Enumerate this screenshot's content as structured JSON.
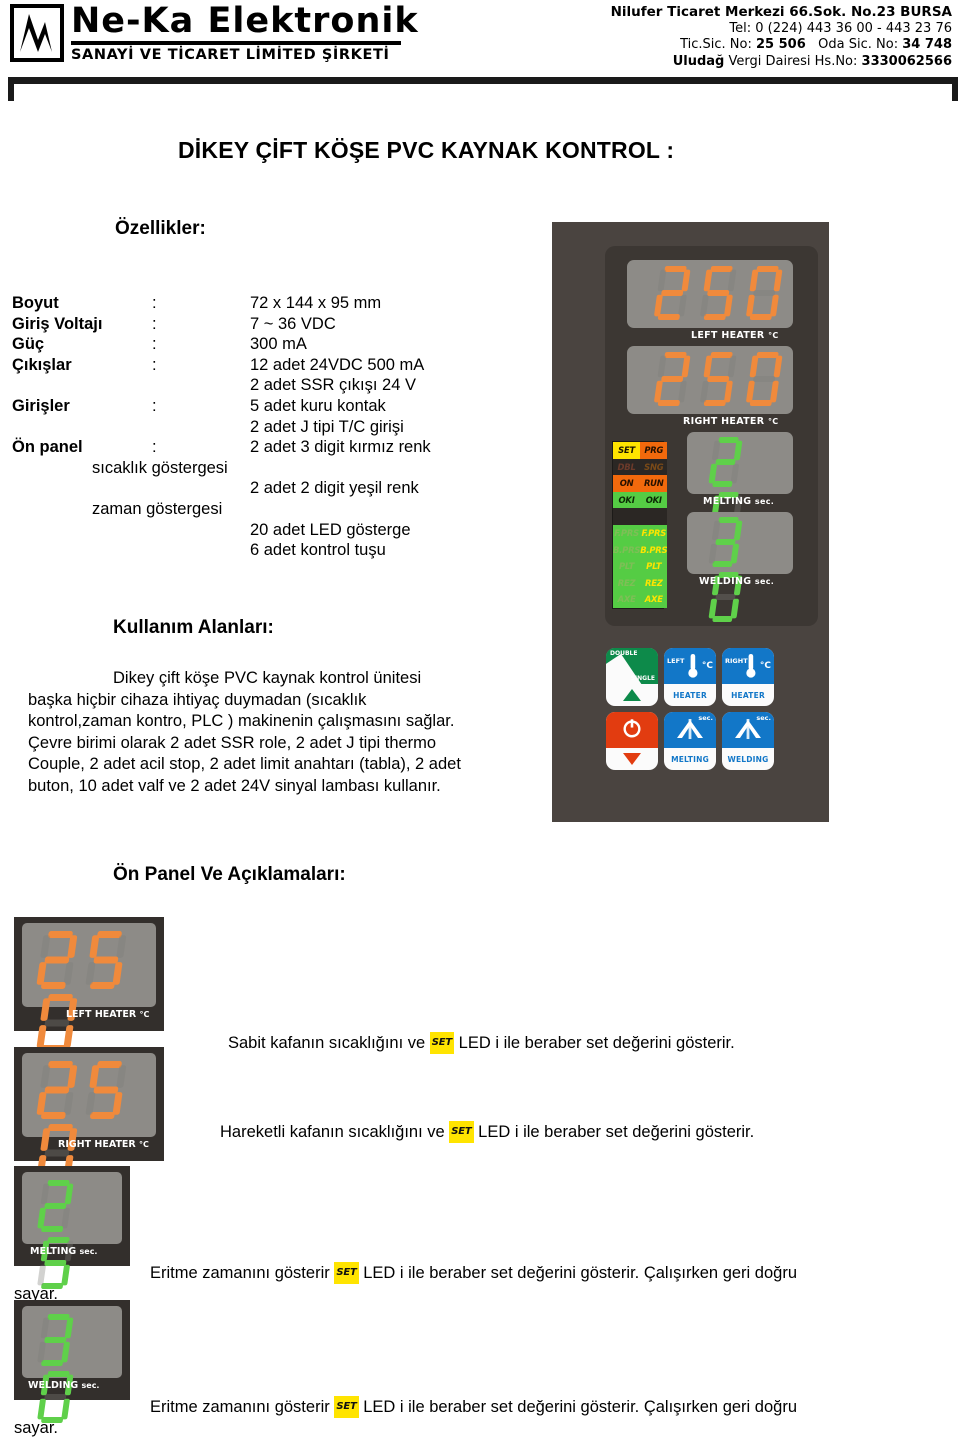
{
  "letterhead": {
    "logo": {
      "brand_main": "Ne-Ka Elektronik",
      "brand_sub": "SANAYİ VE TİCARET LİMİTED ŞİRKETİ",
      "mark_icon": "zigzag-waveform-logo-icon"
    },
    "company": {
      "address": "Nilufer Ticaret Merkezi 66.Sok. No.23 BURSA",
      "phone": "Tel: 0 (224) 443 36 00 - 443 23 76",
      "registry_label_1": "Tic.Sic. No:",
      "registry_value_1": "25 506",
      "registry_label_2": "Oda Sic. No:",
      "registry_value_2": "34 748",
      "tax_office_bold": "Uludağ",
      "tax_office_rest": "Vergi Dairesi  Hs.No:",
      "tax_no": "3330062566"
    }
  },
  "document": {
    "title": "DİKEY ÇİFT KÖŞE PVC KAYNAK KONTROL :",
    "features_heading": "Özellikler:",
    "usage_heading": "Kullanım Alanları:",
    "usage_text": "Dikey çift köşe PVC kaynak kontrol ünitesi başka hiçbir cihaza ihtiyaç duymadan (sıcaklık kontrol,zaman kontro, PLC ) makinenin çalışmasını sağlar. Çevre birimi olarak 2 adet SSR role, 2 adet J tipi thermo Couple, 2 adet acil stop, 2 adet limit anahtarı (tabla), 2 adet buton, 10 adet valf ve 2 adet 24V sinyal lambası kullanır.",
    "panel_heading": "Ön Panel Ve Açıklamaları:"
  },
  "specs": {
    "colon": ":",
    "rows": [
      {
        "label": "Boyut",
        "colon": ":",
        "value": "72 x 144 x 95 mm",
        "extra": []
      },
      {
        "label": "Giriş Voltajı",
        "colon": ":",
        "value": "7 ~ 36 VDC",
        "extra": []
      },
      {
        "label": "Güç",
        "colon": ":",
        "value": "300 mA",
        "extra": []
      },
      {
        "label": "Çıkışlar",
        "colon": ":",
        "value": "12 adet 24VDC 500 mA",
        "extra": [
          "2 adet SSR çıkışı 24 V"
        ]
      },
      {
        "label": "Girişler",
        "colon": ":",
        "value": "5 adet kuru kontak",
        "extra": [
          "2 adet J tipi T/C girişi"
        ]
      },
      {
        "label": "Ön panel",
        "colon": ":",
        "value": "2 adet 3 digit kırmız renk",
        "extra": []
      }
    ],
    "panel_continuation": [
      {
        "text": "sıcaklık göstergesi",
        "wrap": true
      },
      {
        "text": "2 adet 2 digit yeşil renk",
        "wrap": false
      },
      {
        "text": "zaman göstergesi",
        "wrap": true
      },
      {
        "text": "20 adet LED gösterge",
        "wrap": false
      },
      {
        "text": "6 adet kontrol tuşu",
        "wrap": false
      }
    ]
  },
  "device": {
    "displays": [
      {
        "name": "left-heater",
        "value": "250",
        "label": "LEFT HEATER",
        "unit": "°C",
        "color": "#f08a3c"
      },
      {
        "name": "right-heater",
        "value": "250",
        "label": "RIGHT HEATER",
        "unit": "°C",
        "color": "#f08a3c"
      },
      {
        "name": "melting",
        "value": "25",
        "label": "MELTING",
        "unit": "sec.",
        "color": "#5fd04a"
      },
      {
        "name": "welding",
        "value": "30",
        "label": "WELDING",
        "unit": "sec.",
        "color": "#5fd04a"
      }
    ],
    "led_matrix": [
      {
        "left": "SET",
        "left_state": "on-yellow",
        "right": "PRG",
        "right_state": "on-orange"
      },
      {
        "left": "DBL",
        "left_state": "off-red",
        "right": "SNG",
        "right_state": "off-orange"
      },
      {
        "left": "ON",
        "left_state": "on-orange",
        "right": "RUN",
        "right_state": "on-orange"
      },
      {
        "left": "OKI",
        "left_state": "on-green",
        "right": "OKI",
        "right_state": "on-green"
      },
      {
        "left": "",
        "left_state": "blank",
        "right": "",
        "right_state": "blank"
      },
      {
        "left": "F.PRS",
        "left_state": "dim-green",
        "right": "F.PRS",
        "right_state": "on-yellow-green"
      },
      {
        "left": "B.PRS",
        "left_state": "dim-green",
        "right": "B.PRS",
        "right_state": "on-yellow-green"
      },
      {
        "left": "PLT",
        "left_state": "dim-green",
        "right": "PLT",
        "right_state": "on-yellow-green"
      },
      {
        "left": "REZ",
        "left_state": "dim-green",
        "right": "REZ",
        "right_state": "on-yellow-green"
      },
      {
        "left": "AXE",
        "left_state": "dim-green",
        "right": "AXE",
        "right_state": "on-yellow-green"
      }
    ],
    "buttons": [
      {
        "name": "double-single-button",
        "top_text_a": "DOUBLE",
        "top_text_b": "SINGLE",
        "bottom_label": "",
        "icon": "up-triangle-icon",
        "color": "#0d8a4a"
      },
      {
        "name": "left-heater-button",
        "top_text_a": "LEFT",
        "top_text_b": "°C",
        "bottom_label": "HEATER",
        "icon": "thermometer-icon",
        "color": "#1277c8"
      },
      {
        "name": "right-heater-button",
        "top_text_a": "RIGHT",
        "top_text_b": "°C",
        "bottom_label": "HEATER",
        "icon": "thermometer-icon",
        "color": "#1277c8"
      },
      {
        "name": "power-button",
        "top_text_a": "",
        "top_text_b": "",
        "bottom_label": "",
        "icon": "power-icon",
        "color": "#e23c10"
      },
      {
        "name": "melting-button",
        "top_text_a": "",
        "top_text_b": "sec.",
        "bottom_label": "MELTING",
        "icon": "weld-seam-icon",
        "color": "#1277c8"
      },
      {
        "name": "welding-button",
        "top_text_a": "",
        "top_text_b": "sec.",
        "bottom_label": "WELDING",
        "icon": "weld-seam-icon",
        "color": "#1277c8"
      }
    ]
  },
  "panel_explanations": [
    {
      "display_value": "250",
      "display_label": "LEFT HEATER",
      "display_unit": "°C",
      "display_color": "#f08a3c",
      "text_before": "Sabit kafanın sıcaklığını ve",
      "badge": "SET",
      "text_after": "LED i ile beraber set değerini gösterir.",
      "wrap_text": ""
    },
    {
      "display_value": "250",
      "display_label": "RIGHT HEATER",
      "display_unit": "°C",
      "display_color": "#f08a3c",
      "text_before": "Hareketli kafanın sıcaklığını ve",
      "badge": "SET",
      "text_after": "LED i ile beraber set değerini gösterir.",
      "wrap_text": ""
    },
    {
      "display_value": "25",
      "display_label": "MELTING",
      "display_unit": "sec.",
      "display_color": "#5fd04a",
      "text_before": "Eritme zamanını gösterir",
      "badge": "SET",
      "text_after": "LED i ile beraber set değerini gösterir. Çalışırken geri doğru",
      "wrap_text": "sayar."
    },
    {
      "display_value": "30",
      "display_label": "WELDING",
      "display_unit": "sec.",
      "display_color": "#5fd04a",
      "text_before": "Eritme zamanını gösterir",
      "badge": "SET",
      "text_after": "LED i ile beraber set değerini gösterir. Çalışırken geri doğru",
      "wrap_text": "sayar."
    }
  ],
  "colors": {
    "red_segment": "#f08a3c",
    "green_segment": "#5fd04a",
    "led_yellow": "#ffe400",
    "led_orange": "#f2690c",
    "led_green": "#55cc44",
    "device_bezel": "#3c3733",
    "device_bg": "#4a4440",
    "screen_grey": "#8d8b87",
    "button_blue": "#1277c8",
    "button_green": "#0d8a4a",
    "button_red": "#e23c10"
  }
}
